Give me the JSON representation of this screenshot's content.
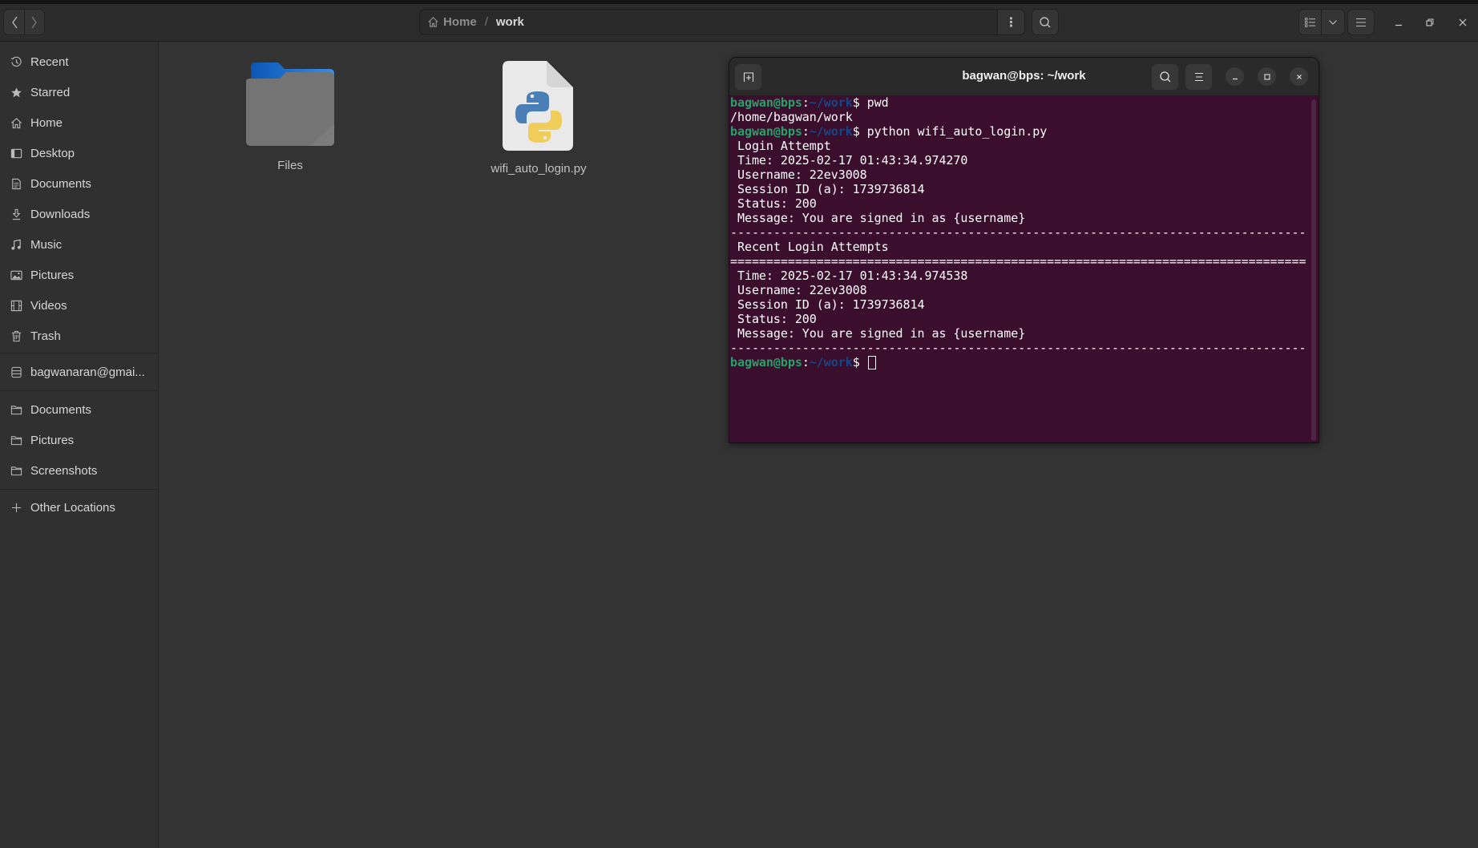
{
  "file_manager": {
    "nav": {
      "back_icon": "chevron-left-icon",
      "forward_icon": "chevron-right-icon"
    },
    "path": {
      "home_label": "Home",
      "separator": "/",
      "current": "work"
    },
    "path_menu_icon": "⋮",
    "search_icon": "search-icon",
    "view_icon": "list-view-icon",
    "menu_icon": "hamburger-icon",
    "window_controls": [
      "minimize",
      "maximize",
      "close"
    ],
    "sidebar": {
      "places": [
        {
          "label": "Recent",
          "icon": "clock-icon"
        },
        {
          "label": "Starred",
          "icon": "star-icon"
        },
        {
          "label": "Home",
          "icon": "home-icon"
        },
        {
          "label": "Desktop",
          "icon": "desktop-icon"
        },
        {
          "label": "Documents",
          "icon": "document-icon"
        },
        {
          "label": "Downloads",
          "icon": "download-icon"
        },
        {
          "label": "Music",
          "icon": "music-icon"
        },
        {
          "label": "Pictures",
          "icon": "picture-icon"
        },
        {
          "label": "Videos",
          "icon": "video-icon"
        },
        {
          "label": "Trash",
          "icon": "trash-icon"
        }
      ],
      "network": [
        {
          "label": "bagwanaran@gmai...",
          "icon": "server-icon"
        }
      ],
      "bookmarks": [
        {
          "label": "Documents",
          "icon": "folder-icon"
        },
        {
          "label": "Pictures",
          "icon": "folder-icon"
        },
        {
          "label": "Screenshots",
          "icon": "folder-icon"
        }
      ],
      "other": {
        "label": "Other Locations",
        "icon": "plus-icon"
      }
    },
    "files": [
      {
        "name": "Files",
        "type": "folder"
      },
      {
        "name": "wifi_auto_login.py",
        "type": "python"
      }
    ]
  },
  "terminal": {
    "title": "bagwan@bps: ~/work",
    "prompt": {
      "user": "bagwan@bps",
      "colon": ":",
      "path": "~/work",
      "dollar": "$"
    },
    "lines": [
      {
        "kind": "prompt",
        "cmd": " pwd"
      },
      {
        "kind": "out",
        "text": "/home/bagwan/work"
      },
      {
        "kind": "prompt",
        "cmd": " python wifi_auto_login.py"
      },
      {
        "kind": "out",
        "text": " Login Attempt"
      },
      {
        "kind": "out",
        "text": " Time: 2025-02-17 01:43:34.974270"
      },
      {
        "kind": "out",
        "text": " Username: 22ev3008"
      },
      {
        "kind": "out",
        "text": " Session ID (a): 1739736814"
      },
      {
        "kind": "out",
        "text": " Status: 200"
      },
      {
        "kind": "out",
        "text": " Message: You are signed in as {username}"
      },
      {
        "kind": "out",
        "text": "--------------------------------------------------------------------------------"
      },
      {
        "kind": "out",
        "text": " Recent Login Attempts"
      },
      {
        "kind": "out",
        "text": "================================================================================"
      },
      {
        "kind": "out",
        "text": " Time: 2025-02-17 01:43:34.974538"
      },
      {
        "kind": "out",
        "text": " Username: 22ev3008"
      },
      {
        "kind": "out",
        "text": " Session ID (a): 1739736814"
      },
      {
        "kind": "out",
        "text": " Status: 200"
      },
      {
        "kind": "out",
        "text": " Message: You are signed in as {username}"
      },
      {
        "kind": "out",
        "text": "--------------------------------------------------------------------------------"
      },
      {
        "kind": "prompt_cursor",
        "cmd": " "
      }
    ]
  }
}
